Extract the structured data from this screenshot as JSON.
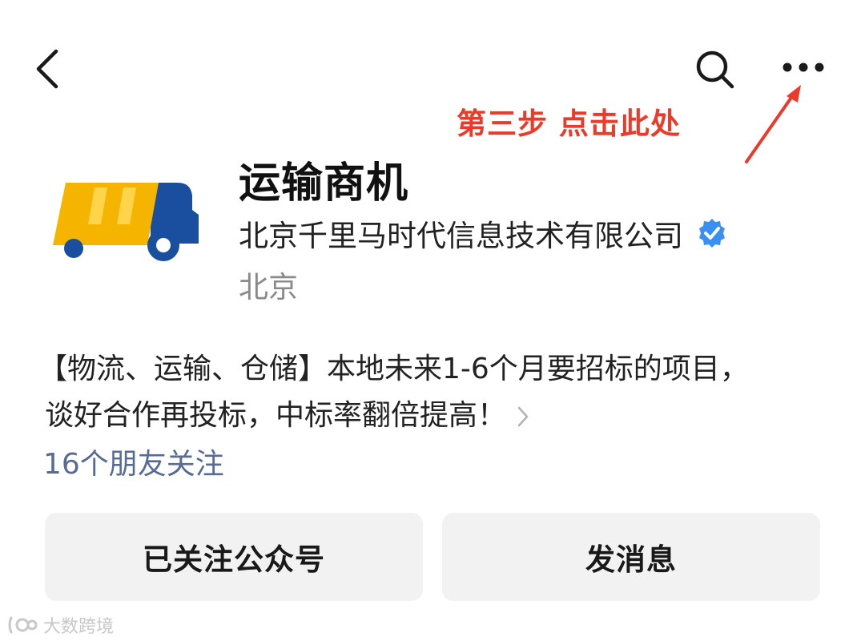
{
  "icons": {
    "back": "back-chevron-icon",
    "search": "search-icon",
    "more": "more-dots-icon",
    "verified": "verified-check-icon",
    "arrow": "red-arrow-icon"
  },
  "annotation": {
    "text": "第三步 点击此处",
    "color": "#ea3b2a"
  },
  "profile": {
    "name": "运输商机",
    "company": "北京千里马时代信息技术有限公司",
    "location": "北京"
  },
  "description": {
    "line1": "【物流、运输、仓储】本地未来1-6个月要招标的项目，",
    "line2": "谈好合作再投标，中标率翻倍提高！"
  },
  "friends_following": "16个朋友关注",
  "buttons": {
    "follow": "已关注公众号",
    "message": "发消息"
  },
  "watermark": "大数跨境",
  "colors": {
    "link": "#576b95",
    "verified": "#3a8ff5",
    "truck_yellow": "#f5b400",
    "truck_blue": "#1a4fa0"
  }
}
